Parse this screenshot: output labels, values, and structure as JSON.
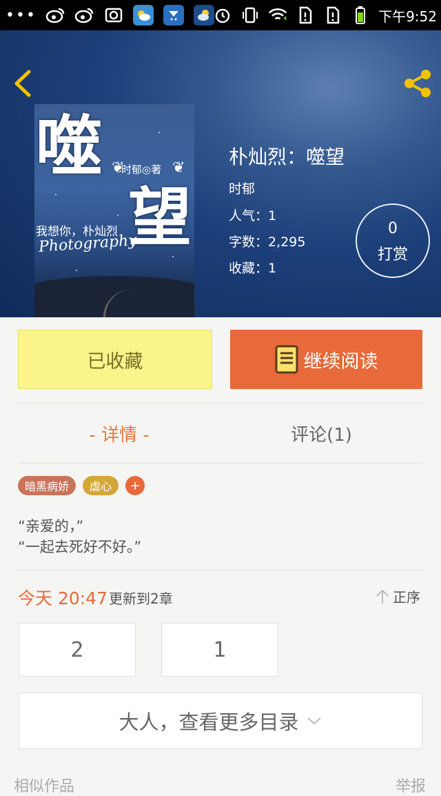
{
  "status_bar": {
    "time": "下午9:52",
    "left_icons": [
      "more-dots-icon",
      "weibo-icon",
      "weibo-icon",
      "screenshot-icon",
      "weather-app-icon",
      "weather-app-icon",
      "weather-app-icon"
    ],
    "right_icons": [
      "alarm-icon",
      "vibrate-icon",
      "wifi-icon",
      "sim1-icon",
      "sim2-icon",
      "battery-icon"
    ]
  },
  "header": {
    "back_icon": "chevron-left-icon",
    "share_icon": "share-icon",
    "accent_color": "#f2c200"
  },
  "cover": {
    "title_char_1": "噬",
    "title_char_2": "望",
    "author_badge": "时郁◎著",
    "subtitle": "我想你，朴灿烈",
    "photo_text": "Photography"
  },
  "book": {
    "title": "朴灿烈：噬望",
    "author": "时郁",
    "popularity_label": "人气：",
    "popularity_value": "1",
    "word_count_label": "字数：",
    "word_count_value": "2,295",
    "favorites_label": "收藏：",
    "favorites_value": "1"
  },
  "tip": {
    "count": "0",
    "label": "打赏"
  },
  "actions": {
    "collected_label": "已收藏",
    "continue_label": "继续阅读"
  },
  "tabs": {
    "details": "- 详情 -",
    "comments": "评论(1)"
  },
  "tags": [
    {
      "label": "暗黑病娇",
      "color": "#c8735a"
    },
    {
      "label": "虐心",
      "color": "#d4a53a"
    }
  ],
  "tag_add": "+",
  "synopsis": {
    "line1": "“亲爱的，”",
    "line2": "“一起去死好不好。”"
  },
  "update": {
    "time": "今天 20:47",
    "text": "更新到2章",
    "sort_label": "正序"
  },
  "chapters": [
    "2",
    "1"
  ],
  "more_catalog": "大人，查看更多目录",
  "footer": {
    "similar": "相似作品",
    "report": "举报"
  }
}
